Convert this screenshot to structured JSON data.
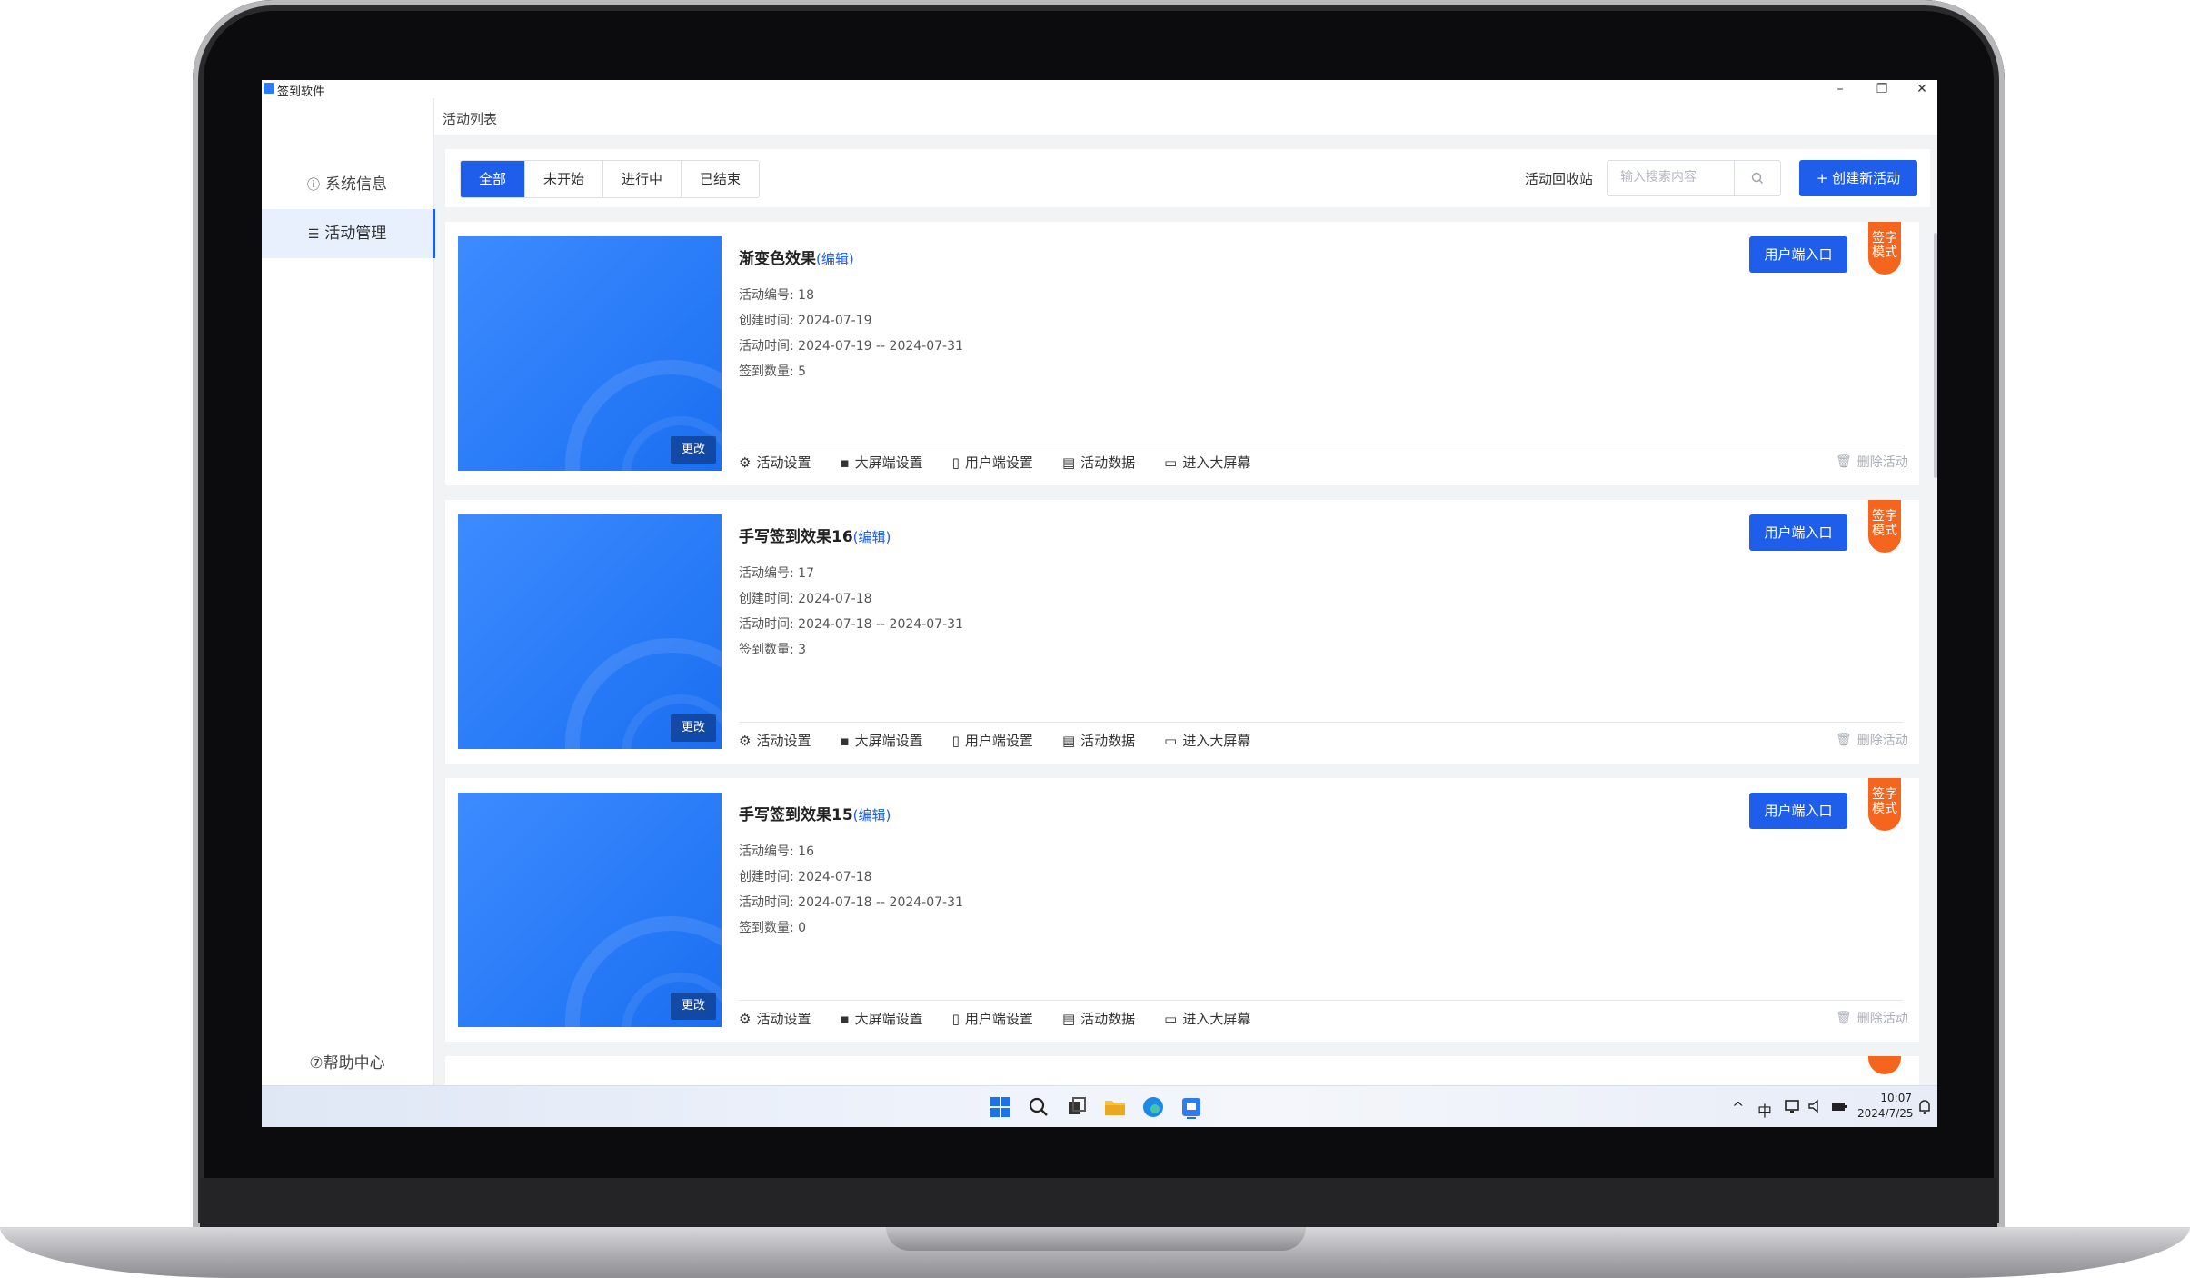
{
  "window": {
    "title": "签到软件"
  },
  "sidebar": {
    "items": [
      {
        "icon": "ⓘ",
        "label": "系统信息"
      },
      {
        "icon": "☰",
        "label": "活动管理"
      }
    ],
    "help": "⑦帮助中心"
  },
  "breadcrumb": "活动列表",
  "toolbar": {
    "tabs": [
      "全部",
      "未开始",
      "进行中",
      "已结束"
    ],
    "recycle": "活动回收站",
    "search_placeholder": "输入搜索内容",
    "create_label": "+ 创建新活动"
  },
  "card_labels": {
    "edit": "(编辑)",
    "change": "更改",
    "user_entry": "用户端入口",
    "mode_badge": "签字 模式",
    "actions": [
      "活动设置",
      "大屏端设置",
      "用户端设置",
      "活动数据",
      "进入大屏幕"
    ],
    "delete": "删除活动"
  },
  "activities": [
    {
      "title": "渐变色效果",
      "id_line": "活动编号: 18",
      "created_line": "创建时间: 2024-07-19",
      "period_line": "活动时间: 2024-07-19 -- 2024-07-31",
      "count_line": "签到数量: 5"
    },
    {
      "title": "手写签到效果16",
      "id_line": "活动编号: 17",
      "created_line": "创建时间: 2024-07-18",
      "period_line": "活动时间: 2024-07-18 -- 2024-07-31",
      "count_line": "签到数量: 3"
    },
    {
      "title": "手写签到效果15",
      "id_line": "活动编号: 16",
      "created_line": "创建时间: 2024-07-18",
      "period_line": "活动时间: 2024-07-18 -- 2024-07-31",
      "count_line": "签到数量: 0"
    }
  ],
  "taskbar": {
    "tray": [
      "^",
      "中"
    ],
    "time": "10:07",
    "date": "2024/7/25"
  },
  "colors": {
    "primary": "#1e5eea",
    "badge": "#f6651d"
  }
}
